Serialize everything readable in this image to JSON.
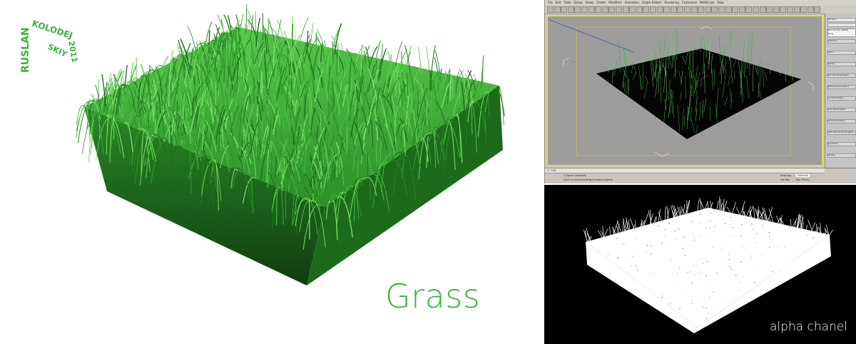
{
  "title": "Grass",
  "watermark": {
    "word1": "RUSLAN",
    "word2": "KOLODEJ",
    "word3": "SKIY",
    "year": "2011"
  },
  "colors": {
    "title_green": "#3cb43a",
    "grass_dark": "#1f6d1e",
    "grass_mid": "#2f9a2a",
    "grass_light": "#5fd24f",
    "viewport_border": "#e5d84b"
  },
  "max_ui": {
    "menu": [
      "File",
      "Edit",
      "Tools",
      "Group",
      "Views",
      "Create",
      "Modifiers",
      "Animation",
      "Graph Editors",
      "Rendering",
      "Customize",
      "MAXScript",
      "Help"
    ],
    "command_panel": {
      "object_name": "Plane01",
      "modifier": "Hair and Fur (WSM)",
      "base": "Plane",
      "rollouts": [
        "Selection",
        "Tools",
        "Styling",
        "General Parameters",
        "Material Parameters",
        "mr Parameters",
        "Frizz Parameters",
        "Kink Parameters",
        "Multi Strand Parameters",
        "Dynamics",
        "Display"
      ]
    },
    "timeline_label": "0 / 100",
    "status_line1": "1 Object Selected",
    "status_line2": "Click or click-and-drag to select objects",
    "auto_key": "Auto Key",
    "set_key": "Set Key",
    "selected": "Selected",
    "key_filters": "Key Filters..."
  },
  "alpha_label": "alpha chanel"
}
